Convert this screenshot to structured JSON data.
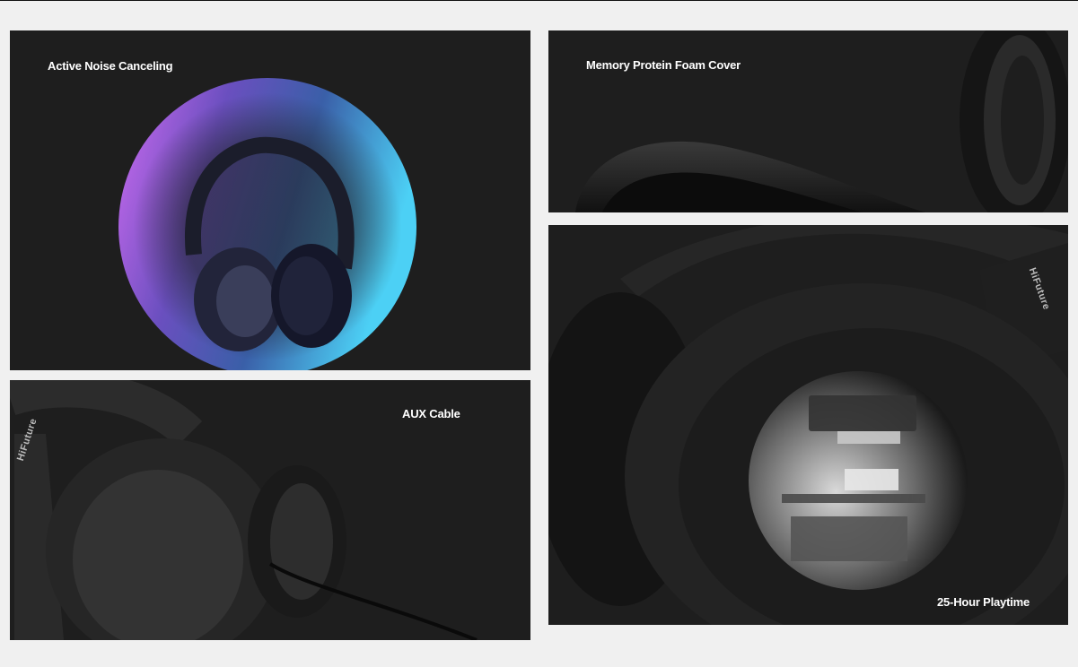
{
  "features": [
    {
      "caption": "Active Noise Canceling"
    },
    {
      "caption": "Memory Protein Foam Cover"
    },
    {
      "caption": "AUX Cable"
    },
    {
      "caption": "25-Hour Playtime"
    }
  ],
  "brand": "HiFuture",
  "colors": {
    "page_background": "#f0f0f0",
    "panel_background": "#1e1e1e",
    "caption_text": "#ffffff",
    "bubble_pink": "#c063f0",
    "bubble_cyan": "#47c2f0"
  }
}
